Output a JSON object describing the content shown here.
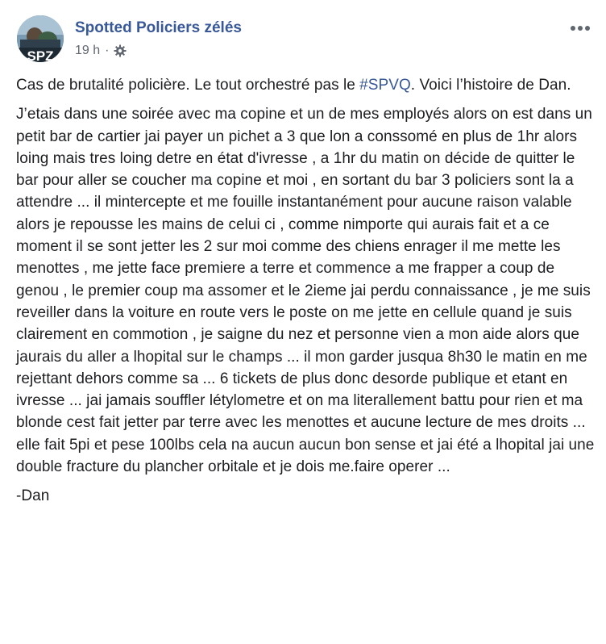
{
  "post": {
    "page_name": "Spotted Policiers zélés",
    "timestamp": "19 h",
    "separator": "·",
    "privacy_icon": "gear-icon",
    "more_icon": "more-horizontal-icon",
    "avatar_text": "SPZ",
    "intro_before": "Cas de brutalité policière. Le tout orchestré pas le ",
    "hashtag": "#SPVQ",
    "intro_after": ". Voici l’histoire de Dan.",
    "story": "J’etais dans une soirée avec ma copine et un de mes employés alors on est dans un petit bar de cartier jai payer un pichet a 3 que lon a conssomé en plus de 1hr alors loing mais tres loing detre en état d'ivresse , a 1hr du matin on décide de quitter le bar pour aller se coucher ma copine et moi , en sortant du bar 3 policiers sont la a attendre ... il mintercepte et me fouille instantanément pour aucune raison valable alors je repousse les mains de celui ci , comme nimporte qui aurais fait et a ce moment il se sont jetter les 2 sur moi comme des chiens enrager il me mette les menottes , me jette face premiere a terre et commence a me frapper a coup de genou , le premier coup ma assomer et le 2ieme jai perdu connaissance , je me suis reveiller dans la voiture en route vers le poste on me jette en cellule quand je suis clairement en commotion , je saigne du nez et personne vien a mon aide alors que jaurais du aller a lhopital sur le champs ... il mon garder jusqua 8h30 le matin en me rejettant dehors comme sa ... 6 tickets de plus donc desorde publique et etant en ivresse ... jai jamais souffler létylometre et on ma literallement battu pour rien et ma blonde cest fait jetter par terre avec les menottes et aucune lecture de mes droits ... elle fait 5pi et pese 100lbs cela na aucun aucun bon sense et jai été a lhopital jai une double fracture du plancher orbitale et je dois me.faire operer ...",
    "signature": "-Dan"
  },
  "colors": {
    "link": "#385898",
    "text": "#1c1e21",
    "meta": "#616770"
  }
}
